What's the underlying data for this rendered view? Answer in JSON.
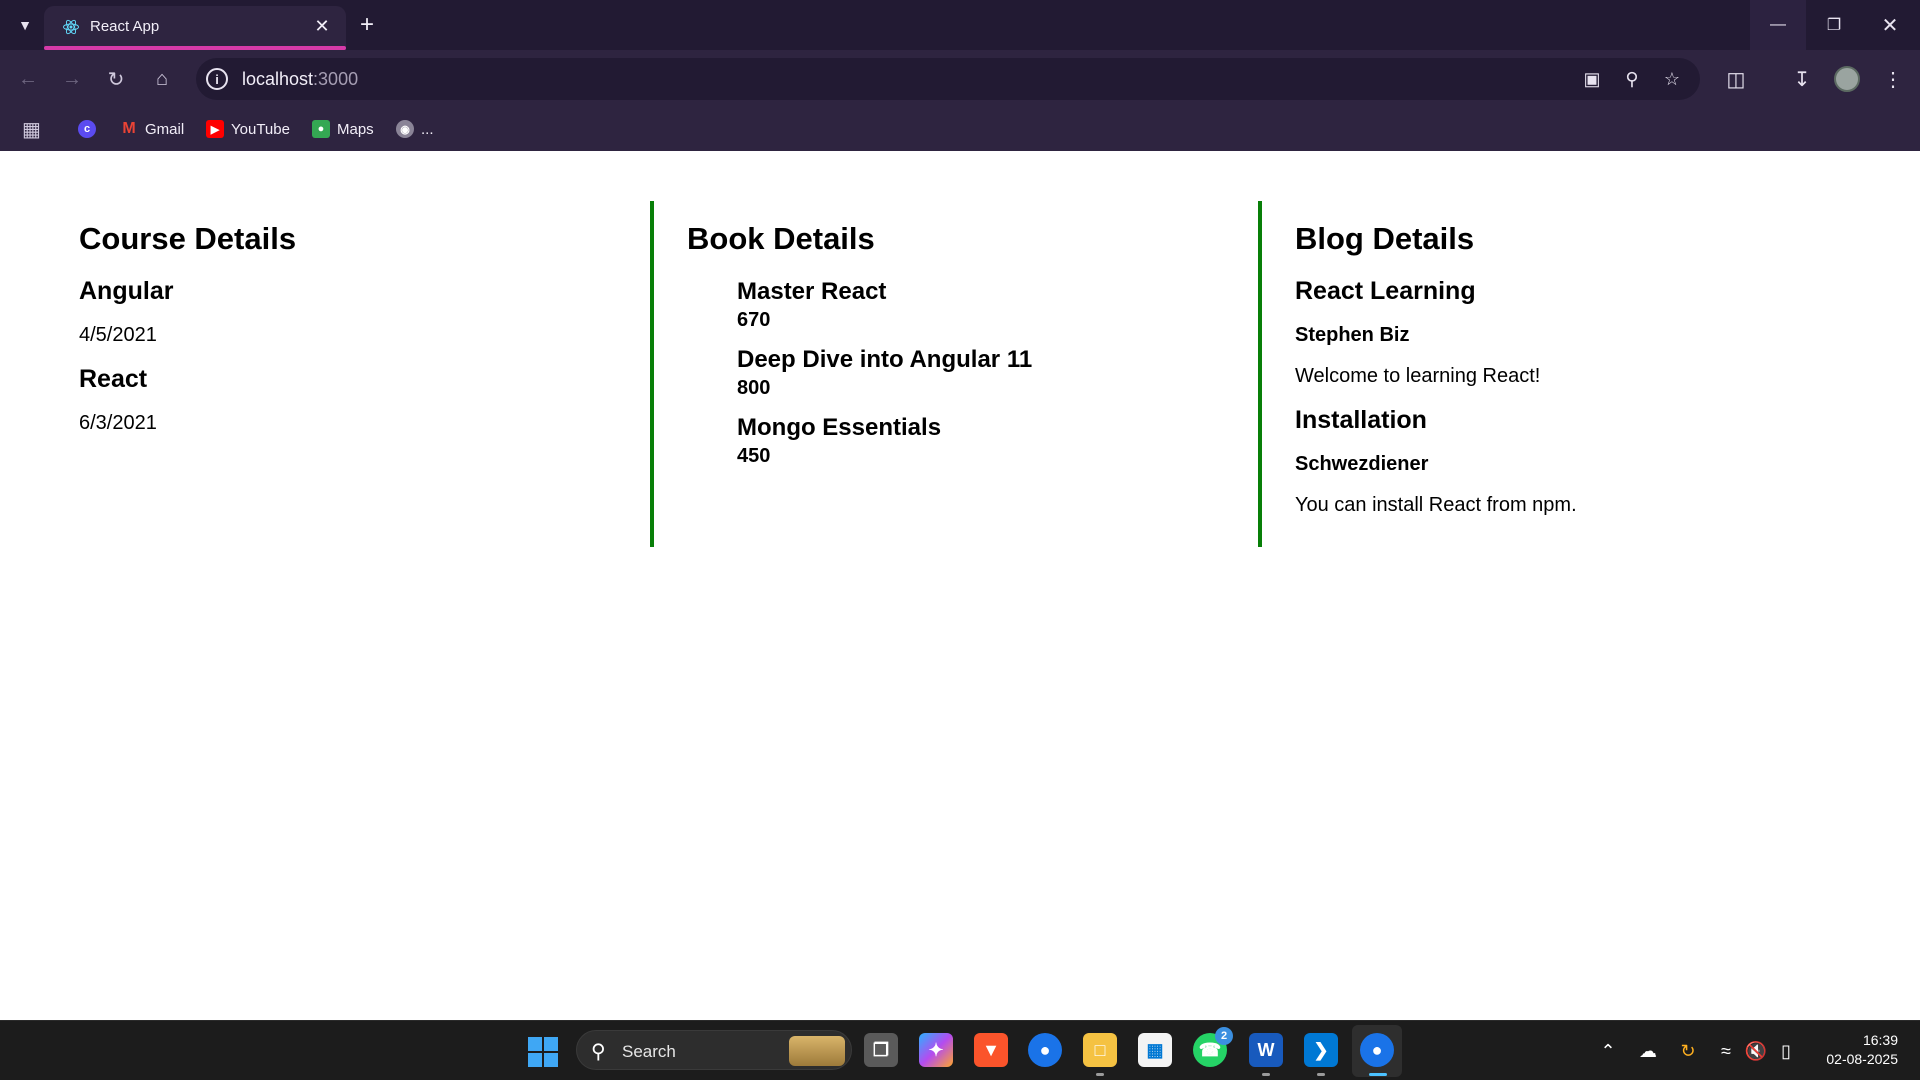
{
  "browser": {
    "tab": {
      "title": "React App"
    },
    "address_bar": {
      "host": "localhost",
      "port": ":3000"
    },
    "bookmarks": [
      {
        "label": "",
        "icon": "c-icon"
      },
      {
        "label": "Gmail",
        "icon": "gmail-icon"
      },
      {
        "label": "YouTube",
        "icon": "youtube-icon"
      },
      {
        "label": "Maps",
        "icon": "maps-icon"
      },
      {
        "label": "...",
        "icon": "globe-icon"
      }
    ]
  },
  "page": {
    "course": {
      "heading": "Course Details",
      "items": [
        {
          "name": "Angular",
          "date": "4/5/2021"
        },
        {
          "name": "React",
          "date": "6/3/2021"
        }
      ]
    },
    "book": {
      "heading": "Book Details",
      "items": [
        {
          "title": "Master React",
          "price": "670"
        },
        {
          "title": "Deep Dive into Angular 11",
          "price": "800"
        },
        {
          "title": "Mongo Essentials",
          "price": "450"
        }
      ]
    },
    "blog": {
      "heading": "Blog Details",
      "items": [
        {
          "title": "React Learning",
          "author": "Stephen Biz",
          "content": "Welcome to learning React!"
        },
        {
          "title": "Installation",
          "author": "Schwezdiener",
          "content": "You can install React from npm."
        }
      ]
    }
  },
  "taskbar": {
    "search_placeholder": "Search",
    "whatsapp_badge": "2",
    "time": "16:39",
    "date": "02-08-2025"
  }
}
